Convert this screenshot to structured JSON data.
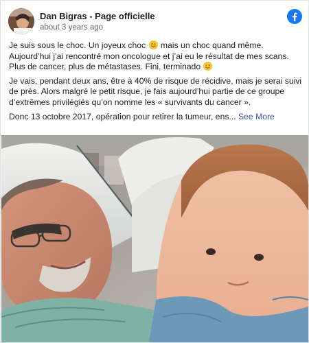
{
  "post": {
    "author": "Dan Bigras - Page officielle",
    "timestamp": "about 3 years ago",
    "paragraphs": [
      {
        "before_emoji": "Je suis sous le choc. Un joyeux choc ",
        "after_emoji": " mais un choc quand même. Aujourd’hui j’ai rencontré mon oncologue et j’ai eu le résultat de mes scans. Plus de cancer, plus de métastases. Fini, terminado ",
        "emojis": [
          "smiley-emoji",
          "wink-emoji"
        ]
      },
      {
        "text": "Je vais, pendant deux ans, être à 40% de risque de récidive, mais je serai suivi de près. Alors malgré le petit risque, je fais aujourd’hui partie de ce groupe d’extrêmes privilégiés qu’on nomme les « survivants du cancer »."
      },
      {
        "text": "Donc 13 octobre 2017, opération pour retirer la tumeur, ens... ",
        "see_more": "See More"
      }
    ]
  },
  "colors": {
    "facebook_blue": "#1877f2",
    "link_blue": "#385898",
    "text": "#1c1e21",
    "muted": "#606770"
  }
}
